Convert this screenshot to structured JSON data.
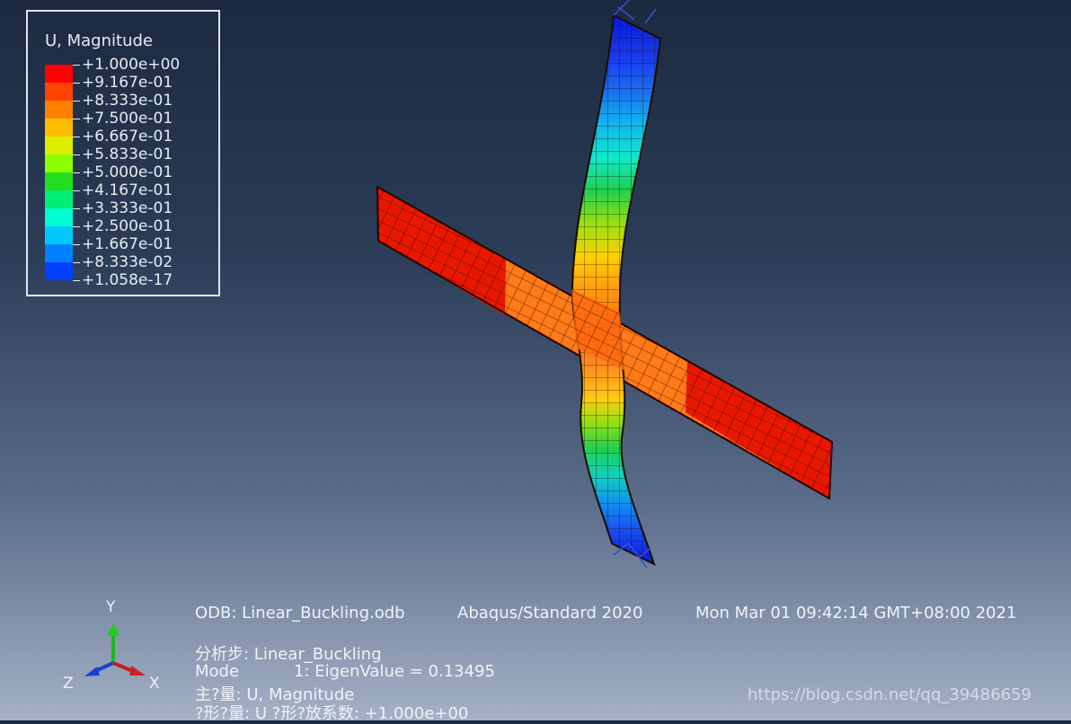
{
  "legend": {
    "title": "U, Magnitude",
    "entries": [
      {
        "label": "+1.000e+00",
        "color": "#ff0000"
      },
      {
        "label": "+9.167e-01",
        "color": "#ff4400"
      },
      {
        "label": "+8.333e-01",
        "color": "#ff8000"
      },
      {
        "label": "+7.500e-01",
        "color": "#ffbf00"
      },
      {
        "label": "+6.667e-01",
        "color": "#ddee00"
      },
      {
        "label": "+5.833e-01",
        "color": "#8cff00"
      },
      {
        "label": "+5.000e-01",
        "color": "#22dd22"
      },
      {
        "label": "+4.167e-01",
        "color": "#00ee77"
      },
      {
        "label": "+3.333e-01",
        "color": "#00ffd0"
      },
      {
        "label": "+2.500e-01",
        "color": "#00c8ff"
      },
      {
        "label": "+1.667e-01",
        "color": "#0080ff"
      },
      {
        "label": "+8.333e-02",
        "color": "#0040ff"
      },
      {
        "label": "+1.058e-17",
        "color": "#0000ff"
      }
    ]
  },
  "triad": {
    "y_label": "Y",
    "z_label": "Z",
    "x_label": "X"
  },
  "info": {
    "odb": "ODB: Linear_Buckling.odb",
    "solver": "Abaqus/Standard 2020",
    "timestamp": "Mon Mar 01 09:42:14 GMT+08:00 2021",
    "step": "分析步: Linear_Buckling",
    "mode_label": "Mode",
    "mode_value": "1: EigenValue =  0.13495",
    "primary_var": "主?量: U, Magnitude",
    "deform_line": "?形?量: U   ?形?放系数: +1.000e+00"
  },
  "watermark": "https://blog.csdn.net/qq_39486659",
  "colors": {
    "background_top": "#1b2a40",
    "background_bottom": "#a4b1c6",
    "mesh_line": "#2a0000"
  }
}
